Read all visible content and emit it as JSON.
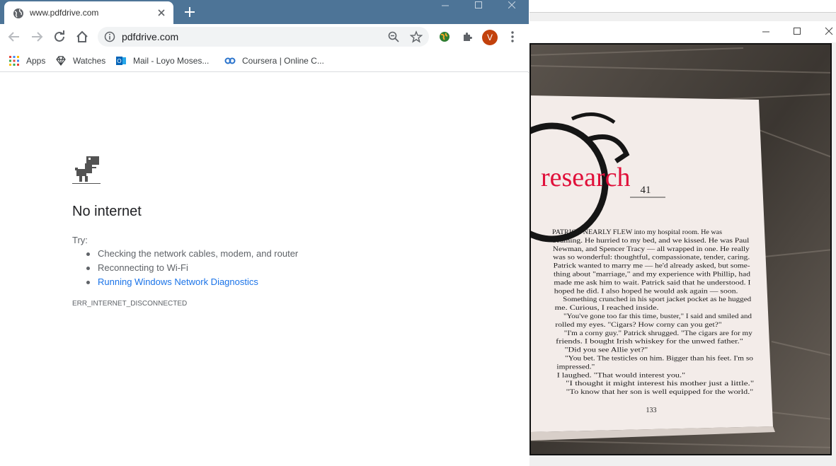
{
  "browser": {
    "tab": {
      "title": "www.pdfdrive.com"
    },
    "address": {
      "url": "pdfdrive.com"
    },
    "avatar_letter": "V",
    "bookmarks": [
      {
        "label": "Apps",
        "icon": "apps-grid-icon"
      },
      {
        "label": "Watches",
        "icon": "diamond-icon"
      },
      {
        "label": "Mail - Loyo Moses...",
        "icon": "outlook-icon"
      },
      {
        "label": "Coursera | Online C...",
        "icon": "coursera-icon"
      }
    ]
  },
  "error_page": {
    "title": "No internet",
    "try_label": "Try:",
    "suggestions": [
      "Checking the network cables, modem, and router",
      "Reconnecting to Wi-Fi",
      "Running Windows Network Diagnostics"
    ],
    "error_code": "ERR_INTERNET_DISCONNECTED"
  },
  "image_viewer": {
    "photo": {
      "overlay_word": "research",
      "page_number_top": "41",
      "page_number_bottom": "133",
      "book_lines": [
        "PATRICK NEARLY FLEW into my hospital room. He was",
        "beaming. He hurried to my bed, and we kissed. He was Paul",
        "Newman, and Spencer Tracy — all wrapped in one. He really",
        "was so wonderful: thoughtful, compassionate, tender, caring.",
        "Patrick wanted to marry me — he'd already asked, but some-",
        "thing about \"marriage,\" and my experience with Phillip, had",
        "made me ask him to wait. Patrick said that he understood. I",
        "hoped he did. I also hoped he would ask again — soon.",
        "Something crunched in his sport jacket pocket as he hugged",
        "me. Curious, I reached inside.",
        "\"You've gone too far this time, buster,\" I said and smiled and",
        "rolled my eyes. \"Cigars? How corny can you get?\"",
        "\"I'm a corny guy.\" Patrick shrugged. \"The cigars are for my",
        "friends. I bought Irish whiskey for the unwed father.\"",
        "\"Did you see Allie yet?\"",
        "\"You bet. The testicles on him. Bigger than his feet. I'm so",
        "impressed.\"",
        "I laughed. \"That would interest you.\"",
        "\"I thought it might interest his mother just a little.\"",
        "\"To know that her son is well equipped for the world.\""
      ]
    }
  },
  "colors": {
    "tabstrip": "#4d7497",
    "link": "#1a73e8",
    "overlay_text": "#e0103a",
    "avatar": "#c2410c"
  }
}
